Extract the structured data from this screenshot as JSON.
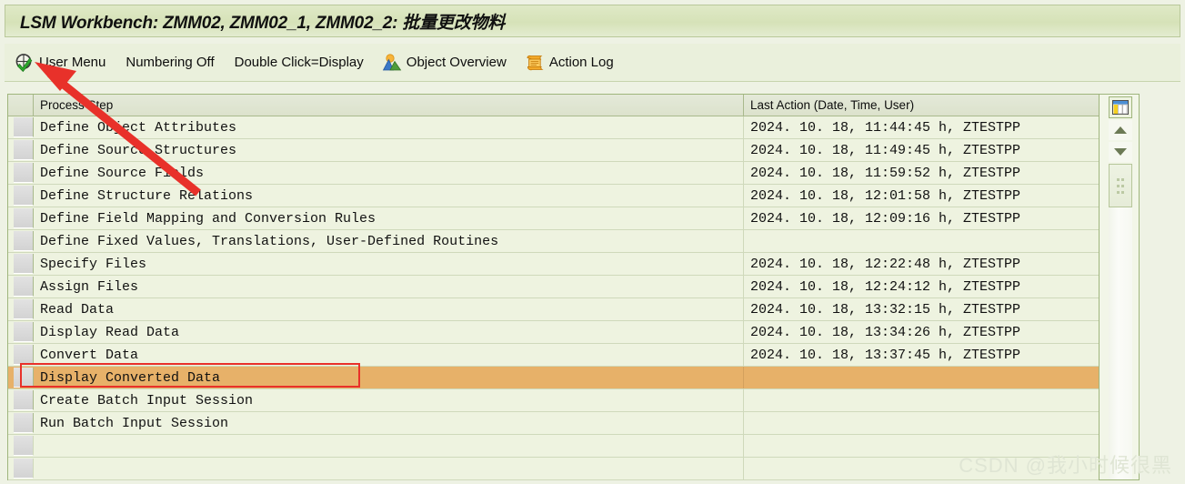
{
  "window": {
    "title": "LSM Workbench: ZMM02, ZMM02_1, ZMM02_2: 批量更改物料"
  },
  "toolbar": {
    "items": [
      {
        "label": "User Menu",
        "icon": "user-menu-check-icon"
      },
      {
        "label": "Numbering Off",
        "icon": ""
      },
      {
        "label": "Double Click=Display",
        "icon": ""
      },
      {
        "label": "Object Overview",
        "icon": "object-overview-icon"
      },
      {
        "label": "Action Log",
        "icon": "action-log-scroll-icon"
      }
    ]
  },
  "table": {
    "headers": {
      "process_step": "Process Step",
      "last_action": "Last Action (Date, Time, User)"
    },
    "rows": [
      {
        "step": "Define Object Attributes",
        "last_action": "2024. 10. 18,  11:44:45 h,  ZTESTPP",
        "selected": false
      },
      {
        "step": "Define Source Structures",
        "last_action": "2024. 10. 18,  11:49:45 h,  ZTESTPP",
        "selected": false
      },
      {
        "step": "Define Source Fields",
        "last_action": "2024. 10. 18,  11:59:52 h,  ZTESTPP",
        "selected": false
      },
      {
        "step": "Define Structure Relations",
        "last_action": "2024. 10. 18,  12:01:58 h,  ZTESTPP",
        "selected": false
      },
      {
        "step": "Define Field Mapping and Conversion Rules",
        "last_action": "2024. 10. 18,  12:09:16 h,  ZTESTPP",
        "selected": false
      },
      {
        "step": "Define Fixed Values, Translations, User-Defined Routines",
        "last_action": "",
        "selected": false
      },
      {
        "step": "Specify Files",
        "last_action": "2024. 10. 18,  12:22:48 h,  ZTESTPP",
        "selected": false
      },
      {
        "step": "Assign Files",
        "last_action": "2024. 10. 18,  12:24:12 h,  ZTESTPP",
        "selected": false
      },
      {
        "step": "Read Data",
        "last_action": "2024. 10. 18,  13:32:15 h,  ZTESTPP",
        "selected": false
      },
      {
        "step": "Display Read Data",
        "last_action": "2024. 10. 18,  13:34:26 h,  ZTESTPP",
        "selected": false
      },
      {
        "step": "Convert Data",
        "last_action": "2024. 10. 18,  13:37:45 h,  ZTESTPP",
        "selected": false
      },
      {
        "step": "Display Converted Data",
        "last_action": "",
        "selected": true
      },
      {
        "step": "Create Batch Input Session",
        "last_action": "",
        "selected": false
      },
      {
        "step": "Run Batch Input Session",
        "last_action": "",
        "selected": false
      }
    ],
    "blank_rows": 2
  },
  "scrollbar": {
    "config_icon": "column-settings-icon",
    "scroll_up_icon": "triangle-up-icon",
    "scroll_down_icon": "triangle-down-icon",
    "thumb_icon": "scrollbar-thumb"
  },
  "annotations": {
    "highlight_box_label": "Display Converted Data",
    "arrow_target": "User Menu",
    "color": "#e8312a"
  },
  "watermark": {
    "text": "CSDN @我小时候很黑"
  },
  "colors": {
    "title_bar": "#dfe9c6",
    "page_bg": "#eef2e4",
    "grid_bg": "#eef3e0",
    "selected_row": "#e7b169",
    "border": "#9fb57c",
    "annotation_red": "#e8312a"
  }
}
